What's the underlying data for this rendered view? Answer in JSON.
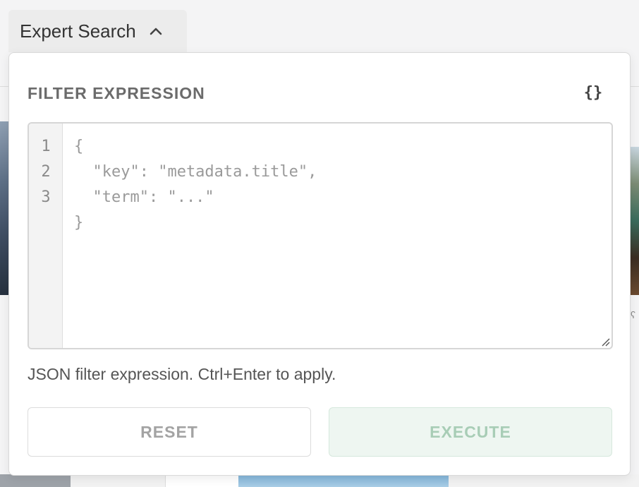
{
  "expert_search": {
    "label": "Expert Search",
    "expanded": true,
    "chevron_icon": "chevron-up-icon"
  },
  "panel": {
    "title": "FILTER EXPRESSION",
    "format_button_label": "{}",
    "editor": {
      "line_numbers": [
        "1",
        "2",
        "3"
      ],
      "lines": [
        "{",
        "  \"key\": \"metadata.title\",",
        "  \"term\": \"...\"",
        "}"
      ]
    },
    "hint": "JSON filter expression. Ctrl+Enter to apply.",
    "reset_label": "RESET",
    "execute_label": "EXECUTE"
  },
  "colors": {
    "execute_bg": "#eef6f1",
    "execute_text": "#a8cdb6",
    "title_text": "#6b6b6b"
  }
}
